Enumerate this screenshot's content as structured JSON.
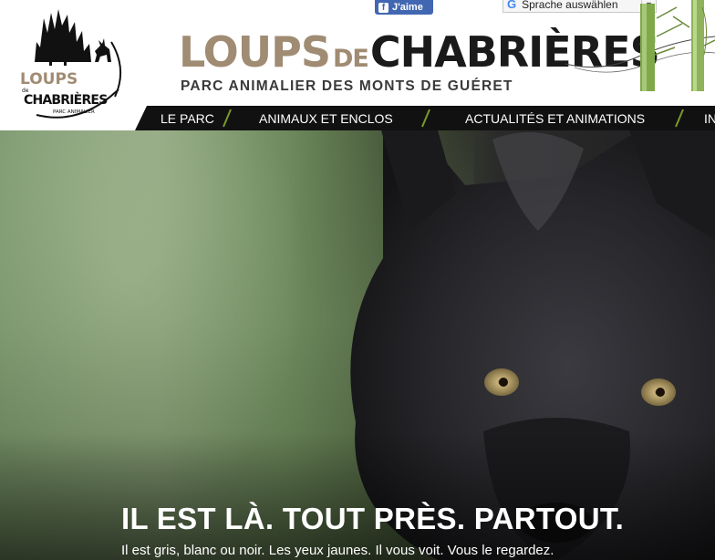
{
  "header": {
    "logo": {
      "line1": "LOUPS",
      "line2": "de",
      "line3": "CHABRIÈRES",
      "tagline": "PARC ANIMALIER"
    },
    "facebook_like_label": "J'aime",
    "translate": {
      "label": "Sprache auswählen",
      "icon": "google-g-icon"
    },
    "title": {
      "part1": "LOUPS",
      "part2": "DE",
      "part3": "CHABRIÈRES"
    },
    "subtitle": "PARC ANIMALIER DES MONTS DE GUÉRET"
  },
  "nav": {
    "items": [
      {
        "label": "LE PARC"
      },
      {
        "label": "ANIMAUX ET ENCLOS"
      },
      {
        "label": "ACTUALITÉS ET ANIMATIONS"
      },
      {
        "label": "IN"
      }
    ]
  },
  "hero": {
    "title": "IL EST LÀ. TOUT PRÈS. PARTOUT.",
    "subtitle": "Il est gris, blanc ou noir. Les yeux jaunes. Il vous voit. Vous le regardez."
  },
  "colors": {
    "brand_tan": "#a08b73",
    "brand_dark": "#1a1a1a",
    "nav_bg": "#111111",
    "nav_separator": "#7a9a2a",
    "facebook_blue": "#4267b2"
  }
}
